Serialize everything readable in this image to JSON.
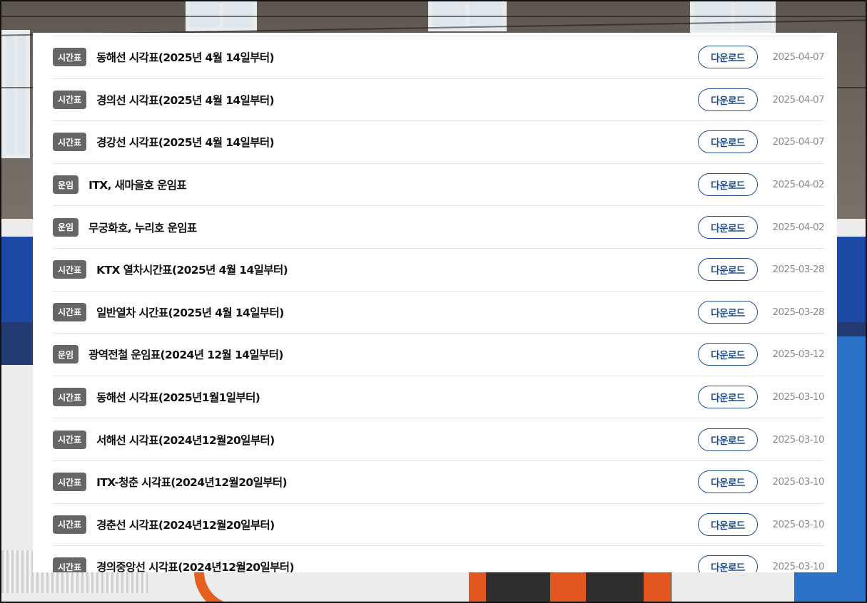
{
  "list": {
    "items": [
      {
        "category": "시간표",
        "title": "동해선 시각표(2025년 4월 14일부터)",
        "button": "다운로드",
        "date": "2025-04-07"
      },
      {
        "category": "시간표",
        "title": "경의선 시각표(2025년 4월 14일부터)",
        "button": "다운로드",
        "date": "2025-04-07"
      },
      {
        "category": "시간표",
        "title": "경강선 시각표(2025년 4월 14일부터)",
        "button": "다운로드",
        "date": "2025-04-07"
      },
      {
        "category": "운임",
        "title": "ITX, 새마을호 운임표",
        "button": "다운로드",
        "date": "2025-04-02"
      },
      {
        "category": "운임",
        "title": "무궁화호, 누리호 운임표",
        "button": "다운로드",
        "date": "2025-04-02"
      },
      {
        "category": "시간표",
        "title": "KTX 열차시간표(2025년 4월 14일부터)",
        "button": "다운로드",
        "date": "2025-03-28"
      },
      {
        "category": "시간표",
        "title": "일반열차 시간표(2025년 4월 14일부터)",
        "button": "다운로드",
        "date": "2025-03-28"
      },
      {
        "category": "운임",
        "title": "광역전철 운임표(2024년 12월 14일부터)",
        "button": "다운로드",
        "date": "2025-03-12"
      },
      {
        "category": "시간표",
        "title": "동해선 시각표(2025년1월1일부터)",
        "button": "다운로드",
        "date": "2025-03-10"
      },
      {
        "category": "시간표",
        "title": "서해선 시각표(2024년12월20일부터)",
        "button": "다운로드",
        "date": "2025-03-10"
      },
      {
        "category": "시간표",
        "title": "ITX-청춘 시각표(2024년12월20일부터)",
        "button": "다운로드",
        "date": "2025-03-10"
      },
      {
        "category": "시간표",
        "title": "경춘선 시각표(2024년12월20일부터)",
        "button": "다운로드",
        "date": "2025-03-10"
      },
      {
        "category": "시간표",
        "title": "경의중앙선 시각표(2024년12월20일부터)",
        "button": "다운로드",
        "date": "2025-03-10"
      }
    ]
  },
  "colors": {
    "badge_bg": "#666666",
    "button_border": "#1f4f8c",
    "date_text": "#8a8a8a"
  }
}
